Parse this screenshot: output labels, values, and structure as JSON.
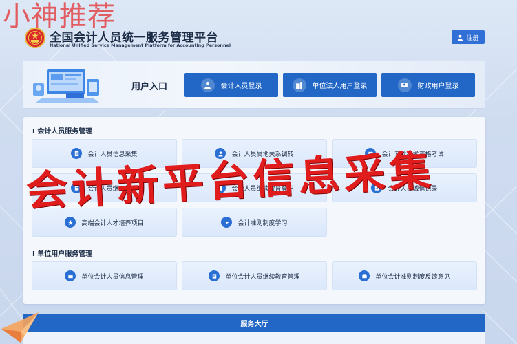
{
  "watermark": {
    "text": "小神推荐"
  },
  "header": {
    "title": "全国会计人员统一服务管理平台",
    "subtitle": "National Unified Service Management Platform for Accounting Personnel",
    "register_label": "注册"
  },
  "login": {
    "section_label": "用户入口",
    "buttons": [
      {
        "label": "会计人员登录",
        "icon": "user-icon"
      },
      {
        "label": "单位法人用户登录",
        "icon": "building-icon"
      },
      {
        "label": "财政用户登录",
        "icon": "id-card-icon"
      }
    ]
  },
  "accountant_services": {
    "title": "I 会计人员服务管理",
    "items": [
      {
        "label": "会计人员信息采集",
        "icon": "form-icon"
      },
      {
        "label": "会计人员属地关系调转",
        "icon": "user-transfer-icon"
      },
      {
        "label": "会计专业技术资格考试",
        "icon": "exam-icon"
      },
      {
        "label": "会计人员继续教育",
        "icon": "education-icon"
      },
      {
        "label": "会计人员继续教育登记",
        "icon": "certificate-icon"
      },
      {
        "label": "会计人员诚信记录",
        "icon": "record-icon"
      },
      {
        "label": "高端会计人才培养项目",
        "icon": "talent-icon"
      },
      {
        "label": "会计准则制度学习",
        "icon": "play-icon"
      }
    ]
  },
  "unit_services": {
    "title": "I 单位用户服务管理",
    "items": [
      {
        "label": "单位会计人员信息管理",
        "icon": "unit-info-icon"
      },
      {
        "label": "单位会计人员继续教育管理",
        "icon": "unit-education-icon"
      },
      {
        "label": "单位会计准则制度反馈意见",
        "icon": "feedback-icon"
      }
    ]
  },
  "overlay": {
    "text": "会计新平台信息采集"
  },
  "footer": {
    "hall_label": "服务大厅"
  },
  "colors": {
    "primary": "#2266c6",
    "accent_red": "#e11c1c",
    "card_bg": "#e2ecfc"
  }
}
